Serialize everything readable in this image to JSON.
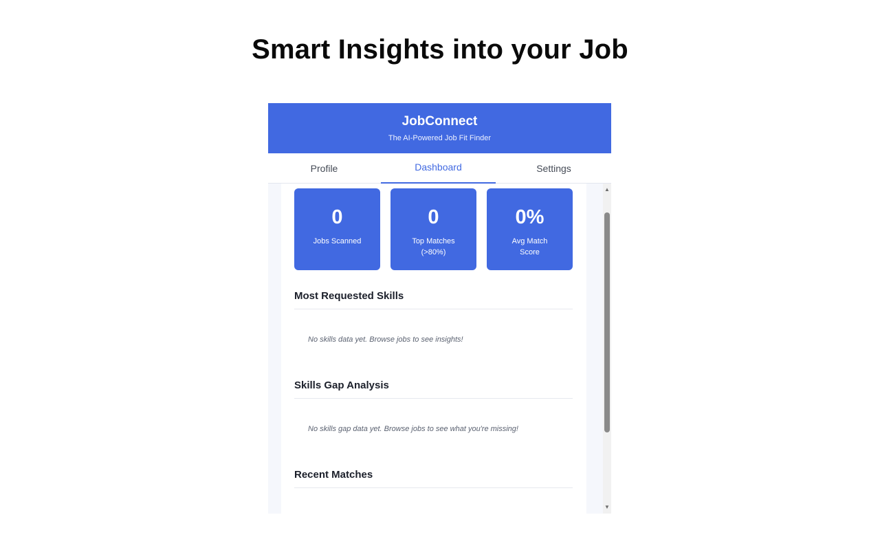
{
  "page": {
    "heading": "Smart Insights into your Job"
  },
  "app": {
    "title": "JobConnect",
    "subtitle": "The AI-Powered Job Fit Finder",
    "accent_color": "#4169e1"
  },
  "tabs": [
    {
      "label": "Profile",
      "active": false
    },
    {
      "label": "Dashboard",
      "active": true
    },
    {
      "label": "Settings",
      "active": false
    }
  ],
  "stats": [
    {
      "value": "0",
      "label": "Jobs Scanned"
    },
    {
      "value": "0",
      "label": "Top Matches (>80%)"
    },
    {
      "value": "0%",
      "label": "Avg Match Score"
    }
  ],
  "sections": {
    "skills": {
      "title": "Most Requested Skills",
      "empty": "No skills data yet. Browse jobs to see insights!"
    },
    "gap": {
      "title": "Skills Gap Analysis",
      "empty": "No skills gap data yet. Browse jobs to see what you're missing!"
    },
    "recent": {
      "title": "Recent Matches"
    }
  },
  "icons": {
    "scroll_up": "chevron-up-icon",
    "scroll_down": "chevron-down-icon"
  }
}
